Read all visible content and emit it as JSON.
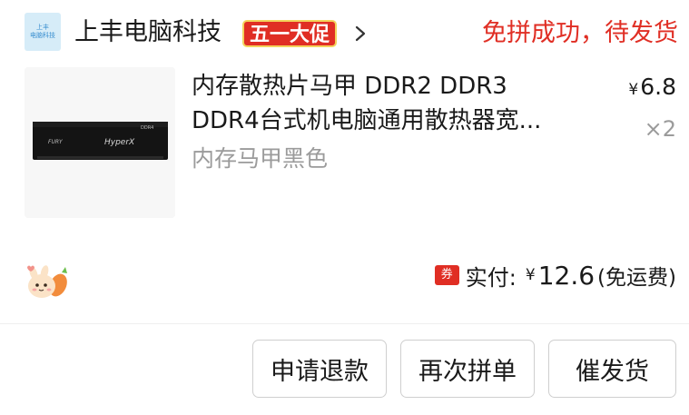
{
  "shop": {
    "logo_line1": "上丰",
    "logo_line2": "电脑科技",
    "name": "上丰电脑科技",
    "promo_badge": "五一大促",
    "status": "免拼成功，待发货"
  },
  "product": {
    "title_line1": "内存散热片马甲 DDR2 DDR3",
    "title_line2": "DDR4台式机电脑通用散热器宽...",
    "spec": "内存马甲黑色",
    "price_currency": "¥",
    "price": "6.8",
    "quantity": "×2",
    "image_text": {
      "brand": "FURY",
      "logo": "HyperX",
      "type": "DDR4"
    }
  },
  "summary": {
    "coupon_icon": "券",
    "paid_label": "实付:",
    "currency": "¥",
    "amount": "12.6",
    "shipping": "(免运费)"
  },
  "actions": {
    "refund": "申请退款",
    "reorder": "再次拼单",
    "urge_ship": "催发货"
  },
  "colors": {
    "accent_red": "#e02e24",
    "muted_text": "#9b9b9b",
    "logo_bg": "#d6ecf8"
  },
  "icons": [
    "chevron-right-icon",
    "mascot-icon",
    "coupon-icon"
  ]
}
